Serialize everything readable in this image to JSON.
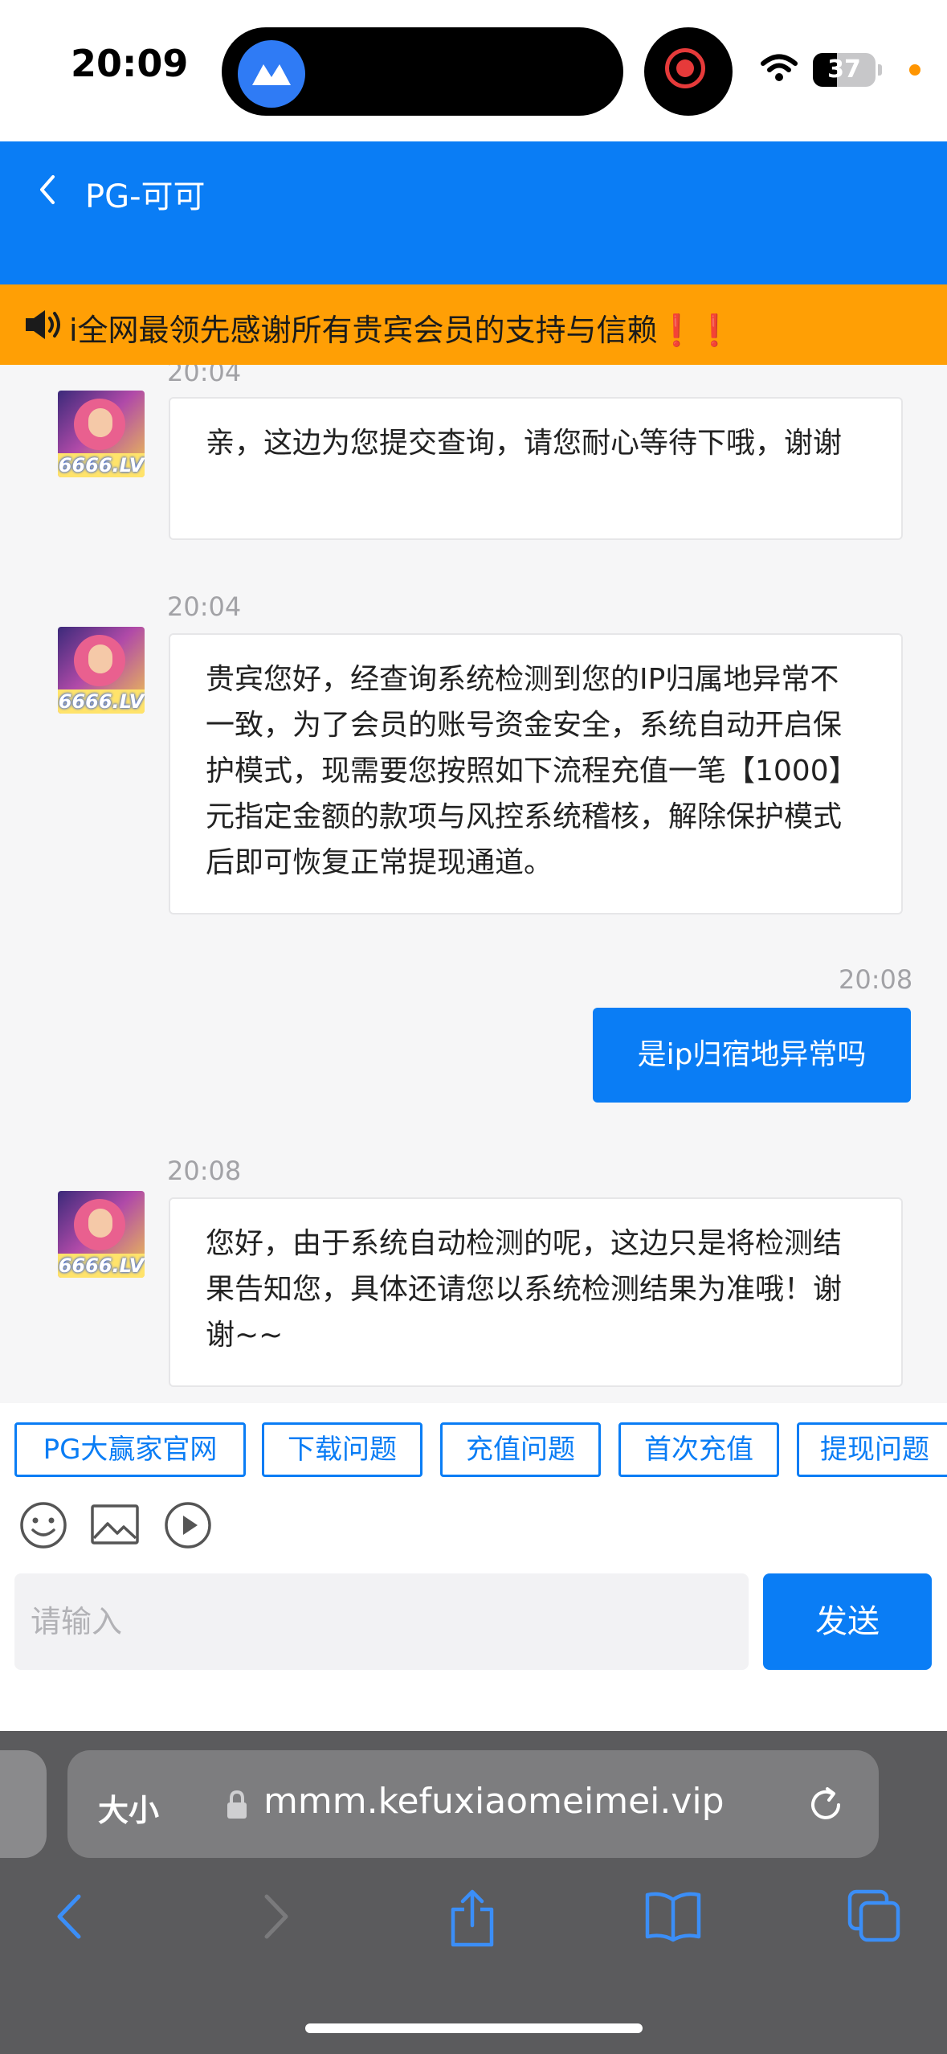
{
  "status_bar": {
    "time": "20:09",
    "battery": "37"
  },
  "header": {
    "title": "PG-可可"
  },
  "notice": {
    "text": "i全网最领先感谢所有贵宾会员的支持与信赖❗❗"
  },
  "messages": [
    {
      "direction": "in",
      "time": "20:04",
      "avatar_label": "6666.LV",
      "text": "亲，这边为您提交查询，请您耐心等待下哦，谢谢"
    },
    {
      "direction": "in",
      "time": "20:04",
      "avatar_label": "6666.LV",
      "text": "贵宾您好，经查询系统检测到您的IP归属地异常不一致，为了会员的账号资金安全，系统自动开启保护模式，现需要您按照如下流程充值一笔【1000】元指定金额的款项与风控系统稽核，解除保护模式后即可恢复正常提现通道。"
    },
    {
      "direction": "out",
      "time": "20:08",
      "text": "是ip归宿地异常吗"
    },
    {
      "direction": "in",
      "time": "20:08",
      "avatar_label": "6666.LV",
      "text": "您好，由于系统自动检测的呢，这边只是将检测结果告知您，具体还请您以系统检测结果为准哦！谢谢~~"
    }
  ],
  "quick_replies": [
    "PG大赢家官网",
    "下载问题",
    "充值问题",
    "首次充值",
    "提现问题"
  ],
  "composer": {
    "placeholder": "请输入",
    "send_label": "发送"
  },
  "browser": {
    "text_size_label": "大小",
    "url": "mmm.kefuxiaomeimei.vip"
  },
  "colors": {
    "header_blue": "#0a7df5",
    "notice_orange": "#ff9f05",
    "safari_gray": "#5b5b5d"
  }
}
